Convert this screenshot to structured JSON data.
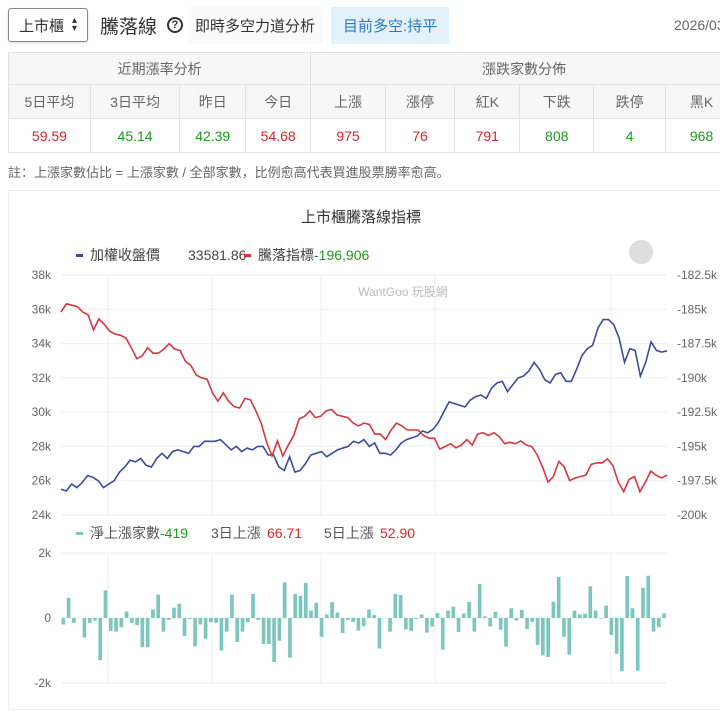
{
  "header": {
    "market_select": "上市櫃",
    "title": "騰落線",
    "subtitle": "即時多空力道分析",
    "state": "目前多空:持平",
    "date": "2026/03/"
  },
  "table": {
    "group1": "近期漲率分析",
    "group2": "漲跌家數分佈",
    "columns": [
      "5日平均",
      "3日平均",
      "昨日",
      "今日",
      "上漲",
      "漲停",
      "紅K",
      "下跌",
      "跌停",
      "黑K"
    ],
    "values": [
      "59.59",
      "45.14",
      "42.39",
      "54.68",
      "975",
      "76",
      "791",
      "808",
      "4",
      "968"
    ],
    "colors": [
      "r",
      "g",
      "g",
      "r",
      "r",
      "r",
      "r",
      "g",
      "g",
      "g"
    ]
  },
  "note": "註：上漲家數佔比 = 上漲家數 / 全部家數，比例愈高代表買進股票勝率愈高。",
  "chart_data": [
    {
      "type": "line",
      "title": "上市櫃騰落線指標",
      "watermark": "WantGoo 玩股網",
      "logo_text": "玩股網",
      "series": [
        {
          "name": "加權收盤價",
          "latest": "33581.86",
          "color": "#3c4a9c",
          "axis": "left",
          "values": [
            25.5,
            25.4,
            25.8,
            25.6,
            25.9,
            26.3,
            26.2,
            26.0,
            25.6,
            25.8,
            26.0,
            26.5,
            26.8,
            27.2,
            27.1,
            27.3,
            26.9,
            26.8,
            27.3,
            27.6,
            27.3,
            27.7,
            27.8,
            27.7,
            27.6,
            28.0,
            28.0,
            28.3,
            28.3,
            28.3,
            28.4,
            28.1,
            27.8,
            28.0,
            27.7,
            27.9,
            27.8,
            28.0,
            28.0,
            27.5,
            27.5,
            26.8,
            26.6,
            27.4,
            26.5,
            26.6,
            27.0,
            27.5,
            27.6,
            27.7,
            27.4,
            27.6,
            27.8,
            27.9,
            28.0,
            28.3,
            28.2,
            28.4,
            28.0,
            28.2,
            27.6,
            27.6,
            27.5,
            27.8,
            28.2,
            28.4,
            28.5,
            28.6,
            28.9,
            28.8,
            29.0,
            29.4,
            30.0,
            30.6,
            30.5,
            30.4,
            30.3,
            30.7,
            30.9,
            31.0,
            30.8,
            31.4,
            31.7,
            31.8,
            31.2,
            31.6,
            32.0,
            32.1,
            32.4,
            32.9,
            32.5,
            31.9,
            31.7,
            32.2,
            32.3,
            31.8,
            31.8,
            32.5,
            33.3,
            33.7,
            33.9,
            34.9,
            35.4,
            35.4,
            35.1,
            34.3,
            32.9,
            33.7,
            33.6,
            32.1,
            32.9,
            34.1,
            33.6,
            33.5,
            33.58
          ]
        },
        {
          "name": "騰落指標",
          "latest": "-196,906",
          "color": "#d9363e",
          "axis": "right",
          "values": [
            -185.2,
            -184.6,
            -184.7,
            -184.8,
            -185.2,
            -185.4,
            -186.5,
            -185.7,
            -186.1,
            -186.6,
            -186.8,
            -186.9,
            -187.1,
            -187.8,
            -188.6,
            -188.4,
            -187.8,
            -188.2,
            -188.2,
            -187.9,
            -187.5,
            -187.9,
            -188.0,
            -188.8,
            -189.1,
            -189.8,
            -190.0,
            -190.1,
            -191.1,
            -191.7,
            -191.1,
            -191.7,
            -192.1,
            -192.2,
            -191.5,
            -191.6,
            -192.4,
            -193.3,
            -194.7,
            -195.7,
            -194.6,
            -195.7,
            -194.9,
            -194.2,
            -193.0,
            -192.8,
            -192.4,
            -192.9,
            -192.8,
            -192.4,
            -192.3,
            -192.7,
            -192.8,
            -192.9,
            -193.3,
            -193.5,
            -193.3,
            -193.4,
            -194.1,
            -194.1,
            -194.5,
            -193.8,
            -193.3,
            -193.5,
            -193.8,
            -193.8,
            -193.8,
            -194.2,
            -194.4,
            -194.4,
            -195.2,
            -195.0,
            -194.8,
            -195.1,
            -194.9,
            -194.5,
            -194.9,
            -194.1,
            -194.0,
            -194.2,
            -194.0,
            -194.3,
            -194.8,
            -194.7,
            -194.8,
            -194.6,
            -194.9,
            -195.0,
            -195.6,
            -196.5,
            -197.6,
            -197.2,
            -196.1,
            -196.5,
            -197.5,
            -197.3,
            -197.2,
            -197.1,
            -196.3,
            -196.2,
            -196.2,
            -195.9,
            -196.4,
            -197.6,
            -198.3,
            -197.4,
            -197.2,
            -198.3,
            -197.6,
            -196.8,
            -197.1,
            -197.3,
            -197.1
          ]
        }
      ],
      "left_ticks": [
        "38k",
        "36k",
        "34k",
        "32k",
        "30k",
        "28k",
        "26k",
        "24k"
      ],
      "left_range": [
        24,
        38
      ],
      "right_ticks": [
        "-182.5k",
        "-185k",
        "-187.5k",
        "-190k",
        "-192.5k",
        "-195k",
        "-197.5k",
        "-200k"
      ],
      "right_range": [
        -200,
        -182.5
      ]
    },
    {
      "type": "bar",
      "legend": [
        {
          "label": "淨上漲家數",
          "value": "-419",
          "cls": "g"
        },
        {
          "label": "3日上漲",
          "value": "66.71",
          "cls": "r"
        },
        {
          "label": "5日上漲",
          "value": "52.90",
          "cls": "r"
        }
      ],
      "color": "#7cc7bd",
      "ticks": [
        "2k",
        "0",
        "-2k"
      ],
      "range": [
        -2000,
        2000
      ],
      "values": [
        -200,
        620,
        -150,
        0,
        -600,
        -150,
        -80,
        -1300,
        850,
        -400,
        -420,
        -280,
        200,
        -150,
        -220,
        -900,
        -900,
        260,
        720,
        -420,
        -60,
        320,
        440,
        -550,
        -30,
        -870,
        -200,
        -640,
        -130,
        -150,
        -1000,
        -420,
        720,
        -740,
        -420,
        -130,
        740,
        -60,
        -800,
        -800,
        -1360,
        -700,
        1100,
        -1220,
        740,
        680,
        1080,
        230,
        470,
        -580,
        110,
        490,
        170,
        -460,
        -60,
        -120,
        -390,
        -250,
        260,
        90,
        -940,
        0,
        -420,
        740,
        710,
        -350,
        -400,
        -30,
        110,
        -450,
        -260,
        150,
        -970,
        230,
        350,
        -430,
        140,
        490,
        -420,
        1050,
        50,
        -260,
        190,
        -360,
        -880,
        300,
        -80,
        250,
        -340,
        -120,
        -830,
        -1150,
        -1200,
        500,
        1260,
        -580,
        -1130,
        230,
        110,
        130,
        980,
        230,
        -20,
        380,
        -520,
        -1100,
        -1640,
        1290,
        300,
        -1620,
        930,
        1300,
        -420,
        -280,
        140
      ]
    }
  ]
}
